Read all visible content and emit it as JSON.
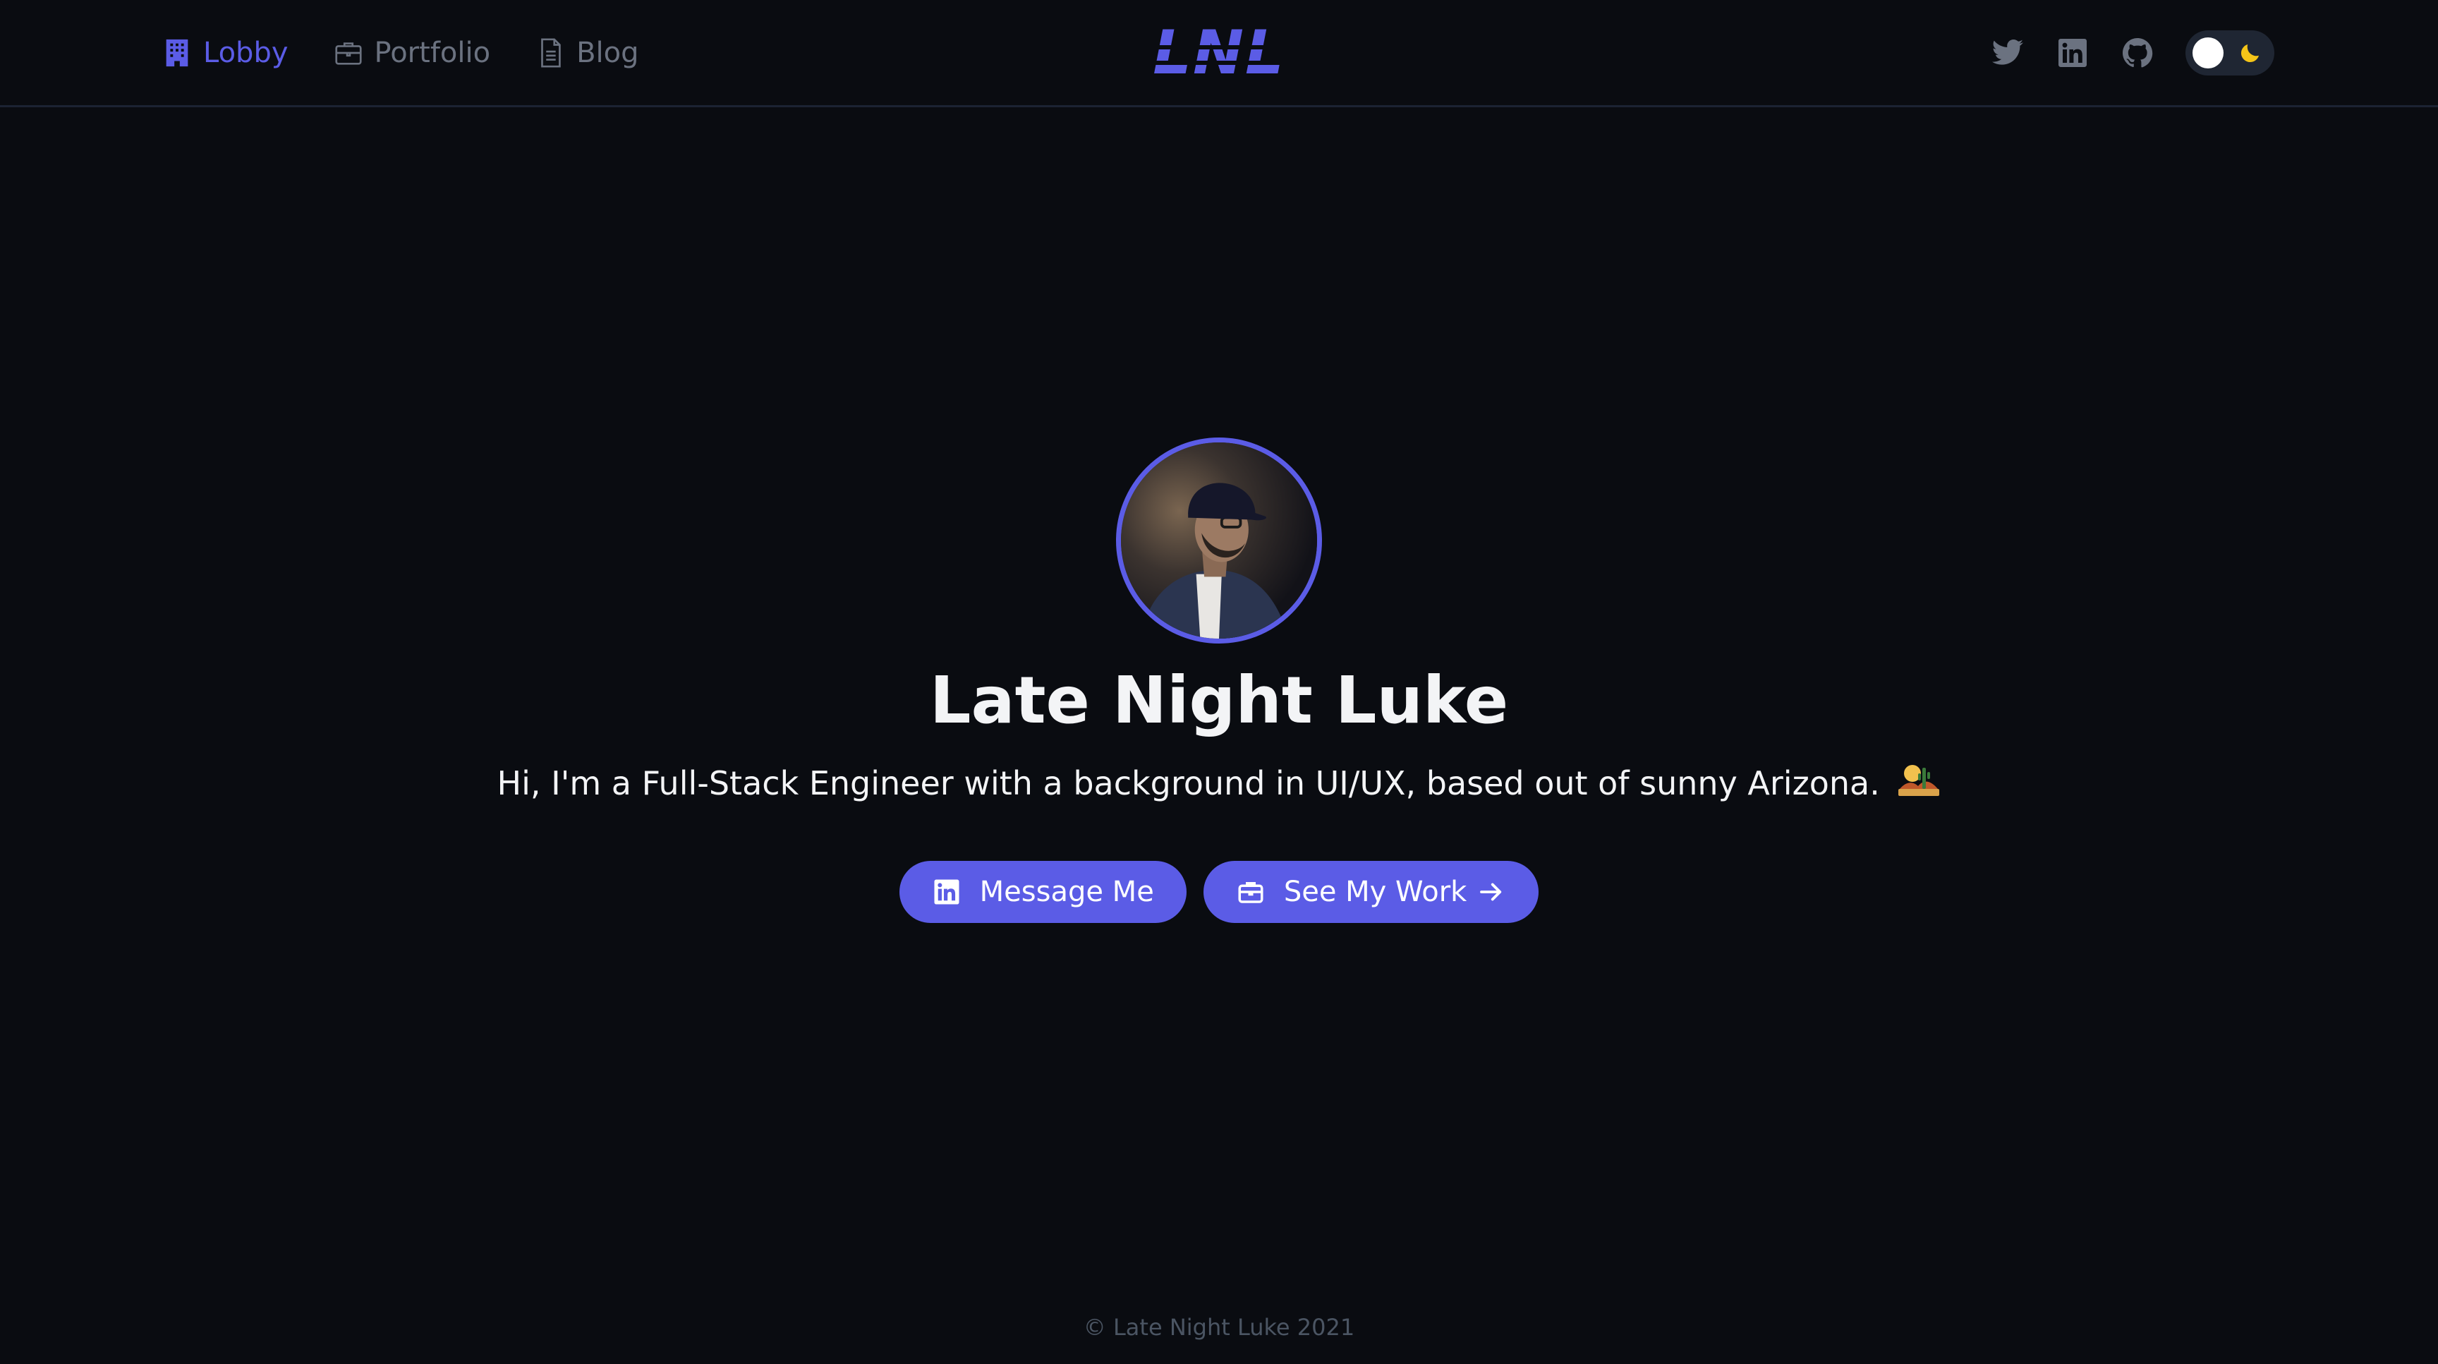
{
  "nav": {
    "items": [
      {
        "label": "Lobby",
        "icon": "building-icon",
        "active": true
      },
      {
        "label": "Portfolio",
        "icon": "briefcase-icon",
        "active": false
      },
      {
        "label": "Blog",
        "icon": "document-icon",
        "active": false
      }
    ]
  },
  "logo": {
    "text": "LNL"
  },
  "social": [
    {
      "icon": "twitter-icon"
    },
    {
      "icon": "linkedin-icon"
    },
    {
      "icon": "github-icon"
    }
  ],
  "theme_toggle": {
    "state": "dark"
  },
  "hero": {
    "name": "Late Night Luke",
    "tagline": "Hi, I'm a Full-Stack Engineer with a background in UI/UX, based out of sunny Arizona.",
    "buttons": {
      "message": "Message Me",
      "work": "See My Work"
    }
  },
  "footer": {
    "text": "© Late Night Luke 2021"
  },
  "colors": {
    "accent": "#5b5ce6",
    "background": "#0a0c11",
    "muted": "#6b7280",
    "text": "#f3f4f6"
  }
}
